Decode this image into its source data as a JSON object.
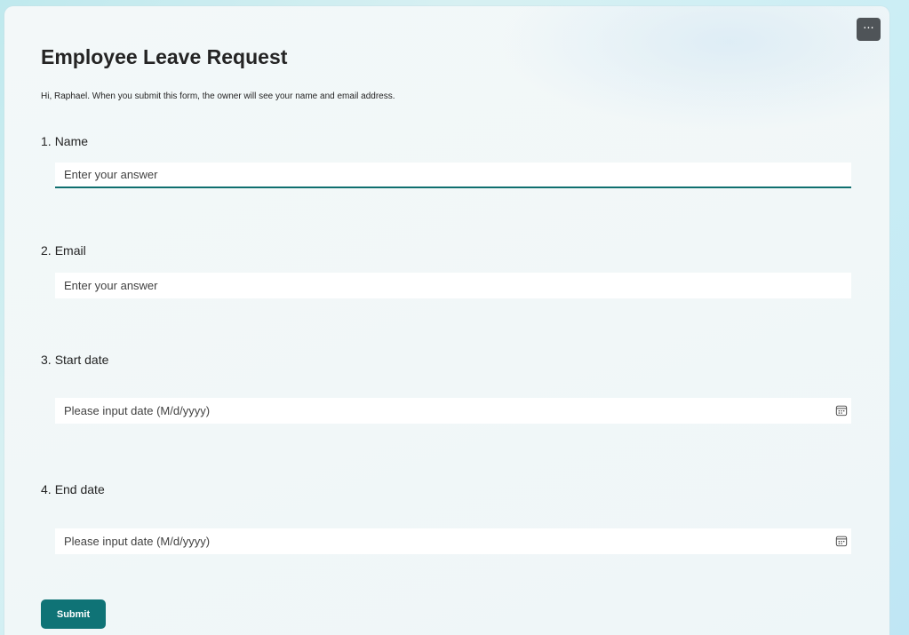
{
  "toolbar": {
    "more_label": "···"
  },
  "form": {
    "title": "Employee Leave Request",
    "notice": "Hi, Raphael. When you submit this form, the owner will see your name and email address.",
    "questions": [
      {
        "number": "1.",
        "label": "Name",
        "placeholder": "Enter your answer"
      },
      {
        "number": "2.",
        "label": "Email",
        "placeholder": "Enter your answer"
      },
      {
        "number": "3.",
        "label": "Start date",
        "placeholder": "Please input date (M/d/yyyy)",
        "icon": "calendar-icon"
      },
      {
        "number": "4.",
        "label": "End date",
        "placeholder": "Please input date (M/d/yyyy)",
        "icon": "calendar-icon"
      }
    ],
    "submit_label": "Submit"
  },
  "colors": {
    "accent": "#0f7376",
    "more_button": "#4f5458",
    "text": "#242424"
  }
}
